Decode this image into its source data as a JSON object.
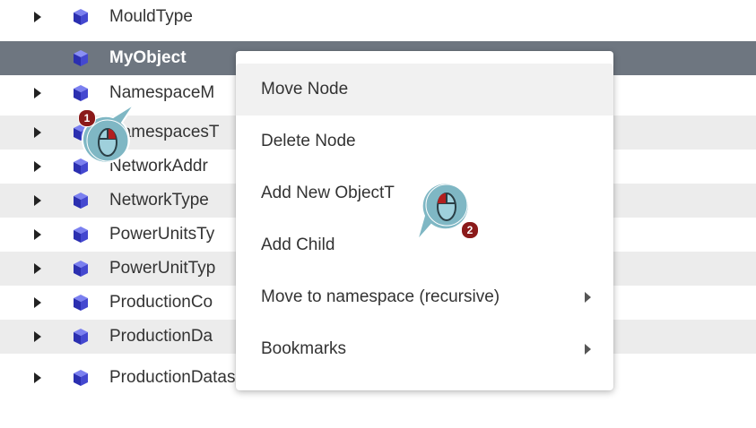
{
  "tree": {
    "items": [
      {
        "label": "MouldType"
      },
      {
        "label": "MyObject"
      },
      {
        "label": "NamespaceM"
      },
      {
        "label": "NamespacesT"
      },
      {
        "label": "NetworkAddr"
      },
      {
        "label": "NetworkType"
      },
      {
        "label": "PowerUnitsTy"
      },
      {
        "label": "PowerUnitTyp"
      },
      {
        "label": "ProductionCo"
      },
      {
        "label": "ProductionDa"
      },
      {
        "label": "ProductionDatasetManagementType"
      }
    ]
  },
  "context_menu": {
    "items": [
      {
        "label": "Move Node"
      },
      {
        "label": "Delete Node"
      },
      {
        "label": "Add New ObjectT"
      },
      {
        "label": "Add Child"
      },
      {
        "label": "Move to namespace (recursive)"
      },
      {
        "label": "Bookmarks"
      }
    ]
  },
  "callouts": [
    {
      "number": "1"
    },
    {
      "number": "2"
    }
  ],
  "colors": {
    "selected_row": "#6e7680",
    "alt_row": "#ececec",
    "cube": "#3b3fc4",
    "callout_fill": "#7fb7c4",
    "badge": "#8b1a1a"
  }
}
